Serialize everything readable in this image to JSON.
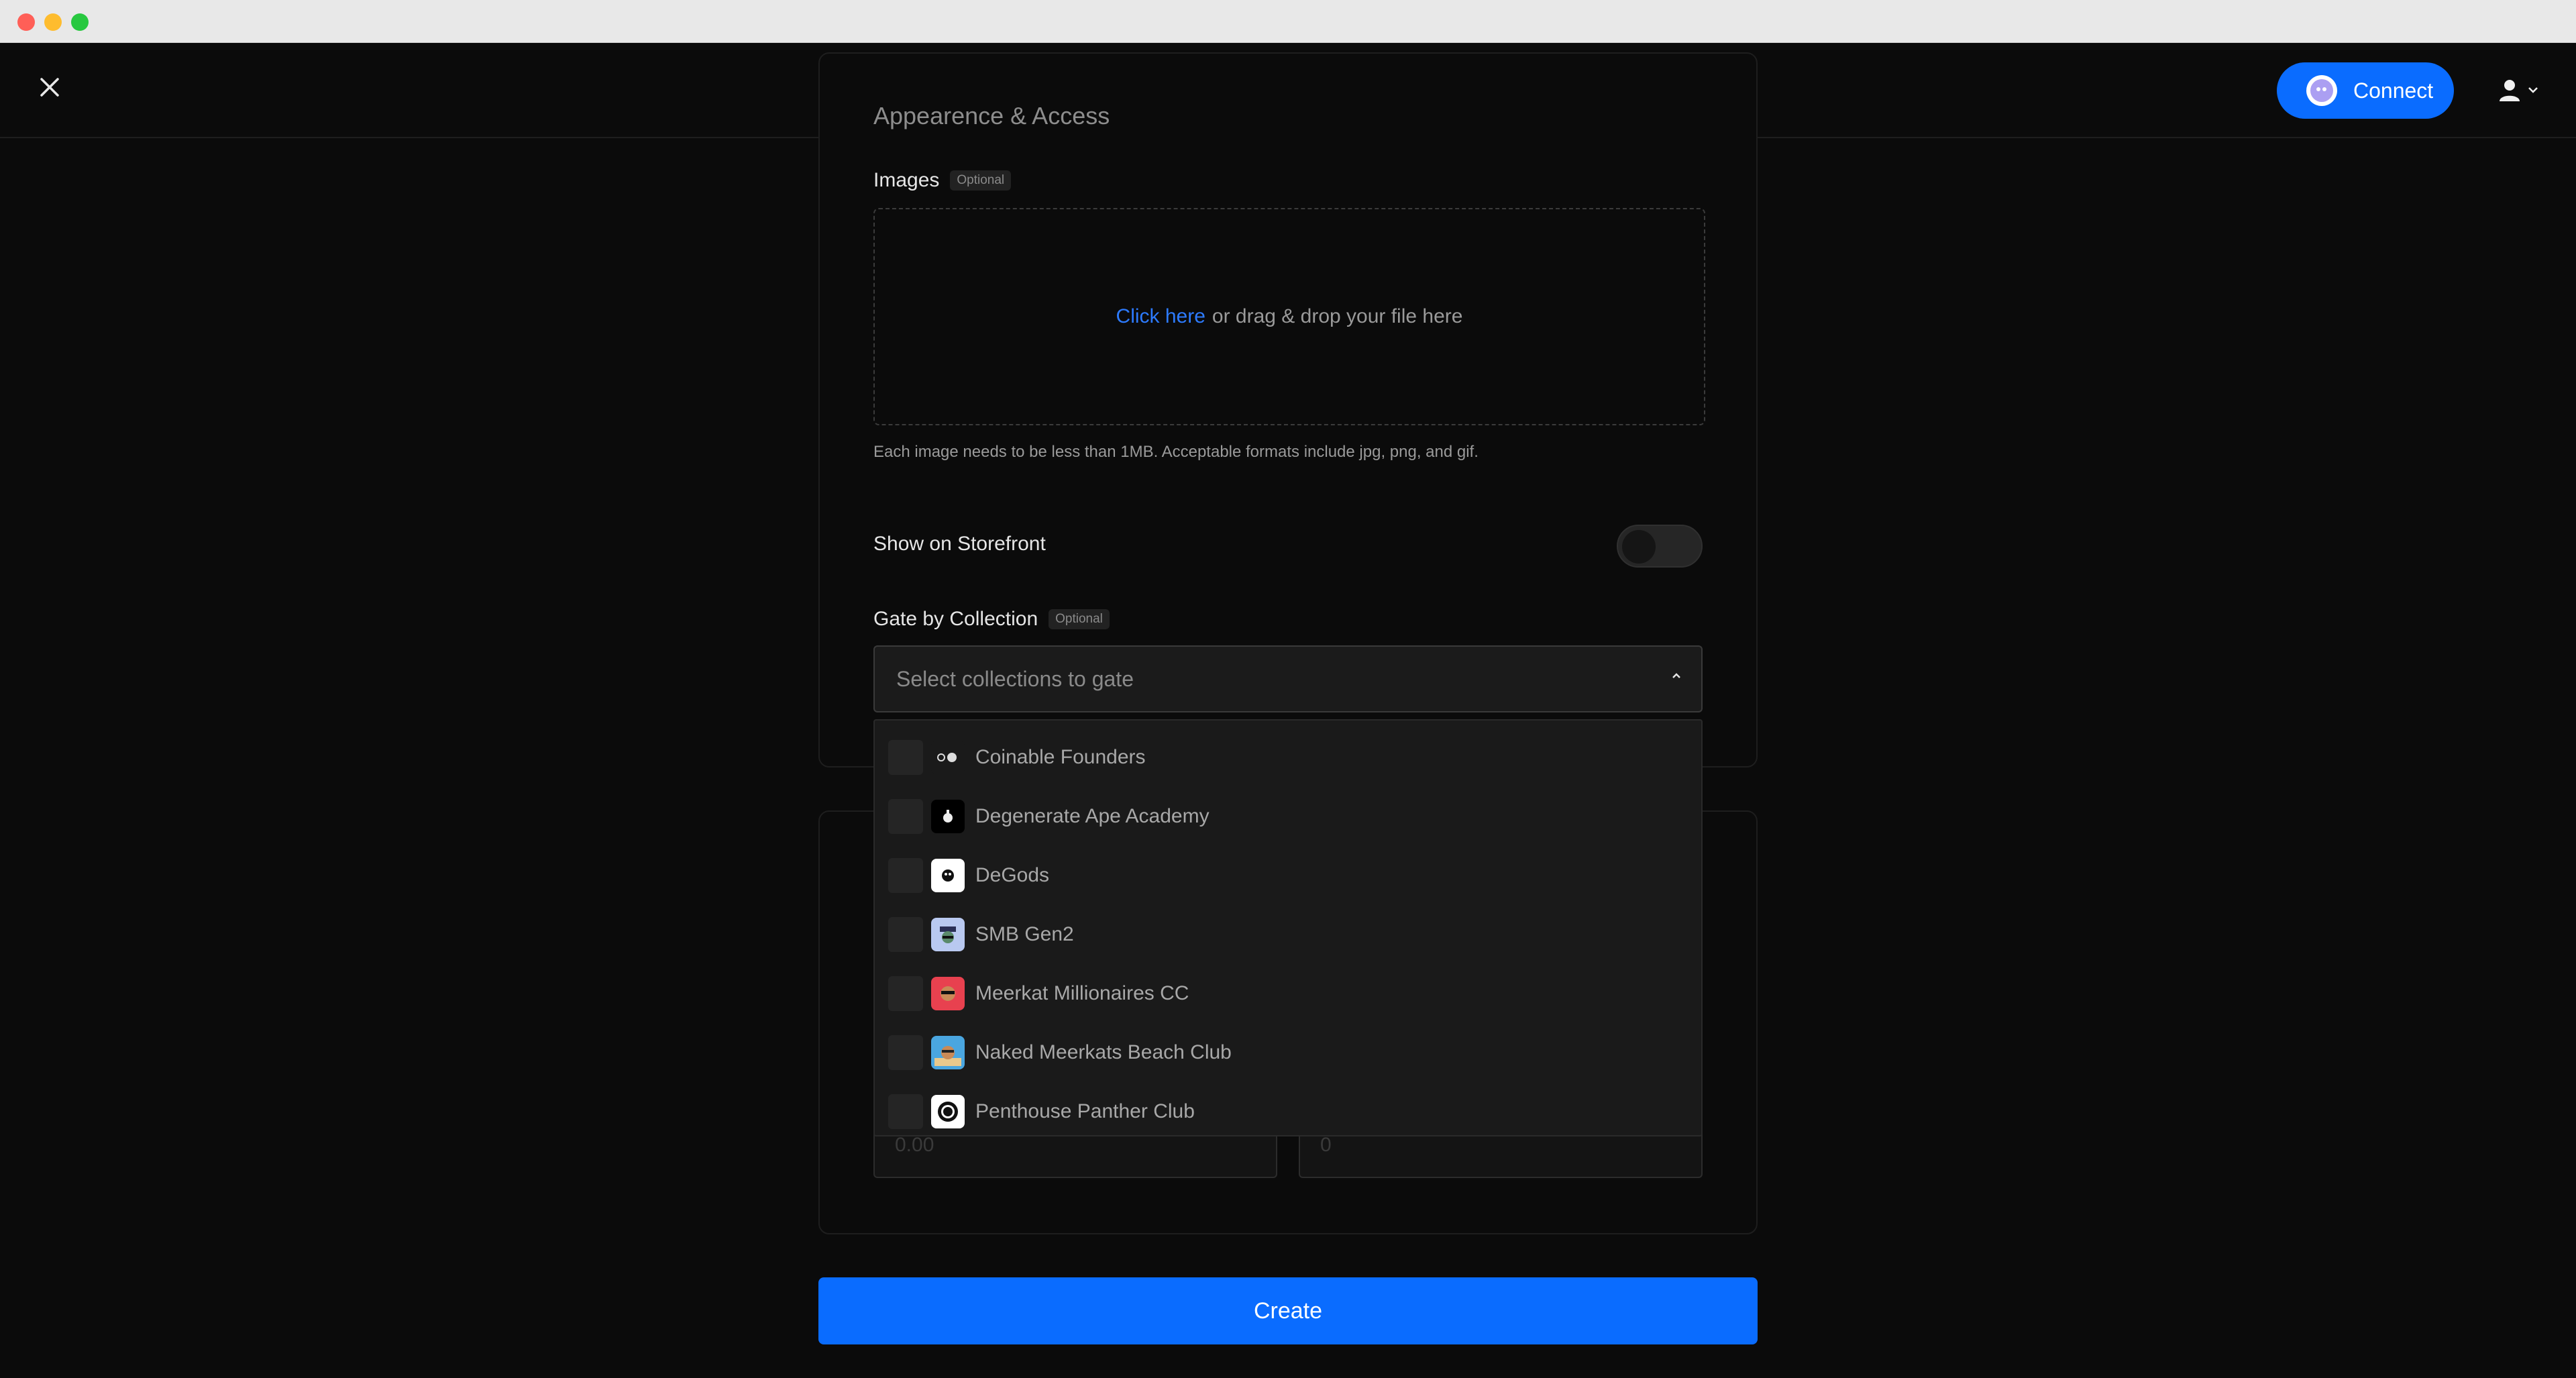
{
  "header": {
    "connect_label": "Connect"
  },
  "form": {
    "section_title": "Appearence & Access",
    "images_label": "Images",
    "optional_badge": "Optional",
    "dropzone_link": "Click here",
    "dropzone_text": "or drag & drop your file here",
    "images_help": "Each image needs to be less than 1MB. Acceptable formats include jpg, png, and gif.",
    "storefront_label": "Show on Storefront",
    "storefront_on": false,
    "gate_label": "Gate by Collection",
    "gate_placeholder": "Select collections to gate",
    "price_placeholder": "0.00",
    "quantity_placeholder": "0",
    "create_label": "Create"
  },
  "collections": [
    {
      "label": "Coinable Founders"
    },
    {
      "label": "Degenerate Ape Academy"
    },
    {
      "label": "DeGods"
    },
    {
      "label": "SMB Gen2"
    },
    {
      "label": "Meerkat Millionaires CC"
    },
    {
      "label": "Naked Meerkats Beach Club"
    },
    {
      "label": "Penthouse Panther Club"
    }
  ],
  "colors": {
    "accent": "#0a6cff",
    "link": "#2d7bff",
    "background": "#0b0b0b"
  }
}
